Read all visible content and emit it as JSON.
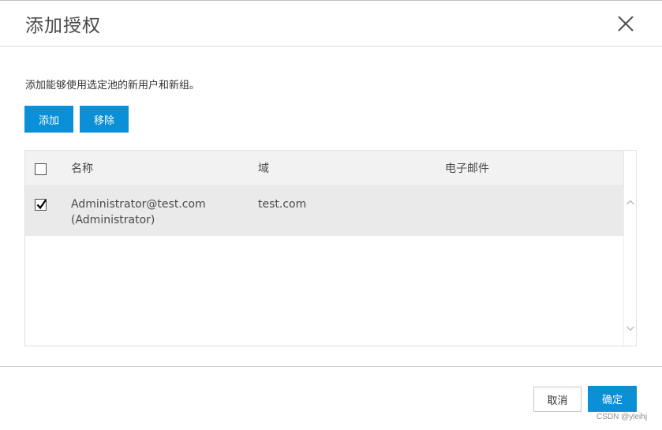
{
  "dialog": {
    "title": "添加授权",
    "description": "添加能够使用选定池的新用户和新组。"
  },
  "toolbar": {
    "add_label": "添加",
    "remove_label": "移除"
  },
  "table": {
    "headers": {
      "name": "名称",
      "domain": "域",
      "email": "电子邮件"
    },
    "rows": [
      {
        "checked": true,
        "name_line1": "Administrator@test.com",
        "name_line2": "(Administrator)",
        "domain": "test.com",
        "email": ""
      }
    ]
  },
  "footer": {
    "cancel_label": "取消",
    "ok_label": "确定"
  },
  "watermark": "CSDN @yleihj",
  "colors": {
    "primary": "#0b8fd6",
    "header_bg": "#f2f2f2",
    "selected_row_bg": "#eaeaea"
  }
}
